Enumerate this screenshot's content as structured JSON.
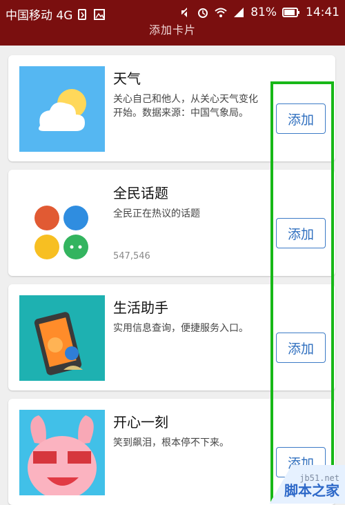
{
  "status_bar": {
    "carrier": "中国移动 4G",
    "battery": "81%",
    "time": "14:41"
  },
  "header": {
    "title": "添加卡片"
  },
  "cards": [
    {
      "title": "天气",
      "description": "关心自己和他人，从关心天气变化开始。数据来源：中国气象局。",
      "count": "",
      "button": "添加",
      "icon": "weather-icon"
    },
    {
      "title": "全民话题",
      "description": "全民正在热议的话题",
      "count": "547,546",
      "button": "添加",
      "icon": "topic-dots-icon"
    },
    {
      "title": "生活助手",
      "description": "实用信息查询，便捷服务入口。",
      "count": "",
      "button": "添加",
      "icon": "life-assistant-icon"
    },
    {
      "title": "开心一刻",
      "description": "笑到飙泪，根本停不下来。",
      "count": "",
      "button": "添加",
      "icon": "happy-moment-icon"
    }
  ],
  "watermark": {
    "site": "jb51.net",
    "name": "脚本之家"
  },
  "colors": {
    "status_bar": "#7a0f0f",
    "highlight": "#18b818",
    "button_text": "#2f6fbf"
  }
}
